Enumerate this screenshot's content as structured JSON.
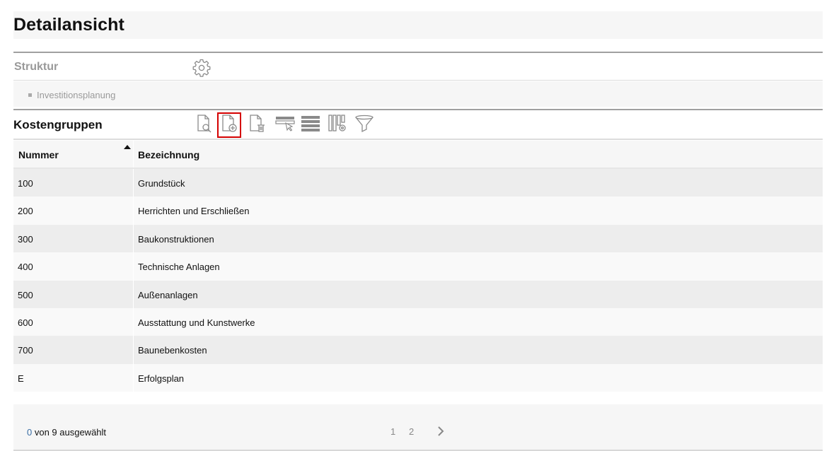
{
  "page": {
    "title": "Detailansicht"
  },
  "struktur": {
    "label": "Struktur",
    "settings_icon": "gear-icon",
    "tree_items": [
      {
        "label": "Investitionsplanung"
      }
    ]
  },
  "kostengruppen": {
    "label": "Kostengruppen",
    "toolbar": [
      {
        "icon": "document-search-icon",
        "active": false
      },
      {
        "icon": "document-add-icon",
        "active": true
      },
      {
        "icon": "document-delete-icon",
        "active": false
      },
      {
        "icon": "row-select-icon",
        "active": false
      },
      {
        "icon": "rows-layout-icon",
        "active": false
      },
      {
        "icon": "column-settings-icon",
        "active": false
      },
      {
        "icon": "filter-icon",
        "active": false
      }
    ]
  },
  "table": {
    "columns": [
      {
        "label": "Nummer",
        "sorted": "ascending"
      },
      {
        "label": "Bezeichnung"
      }
    ],
    "rows": [
      {
        "nummer": "100",
        "bezeichnung": "Grundstück"
      },
      {
        "nummer": "200",
        "bezeichnung": "Herrichten und Erschließen"
      },
      {
        "nummer": "300",
        "bezeichnung": "Baukonstruktionen"
      },
      {
        "nummer": "400",
        "bezeichnung": "Technische Anlagen"
      },
      {
        "nummer": "500",
        "bezeichnung": "Außenanlagen"
      },
      {
        "nummer": "600",
        "bezeichnung": "Ausstattung und Kunstwerke"
      },
      {
        "nummer": "700",
        "bezeichnung": "Baunebenkosten"
      },
      {
        "nummer": "E",
        "bezeichnung": "Erfolgsplan"
      }
    ]
  },
  "footer": {
    "selected_count": "0",
    "selection_text": " von 9 ausgewählt",
    "pages": [
      "1",
      "2"
    ],
    "next_icon": "chevron-right-icon"
  },
  "colors": {
    "accent_active": "#d40000",
    "link_blue": "#3a6ea5",
    "icon_gray": "#8a8a8a"
  }
}
